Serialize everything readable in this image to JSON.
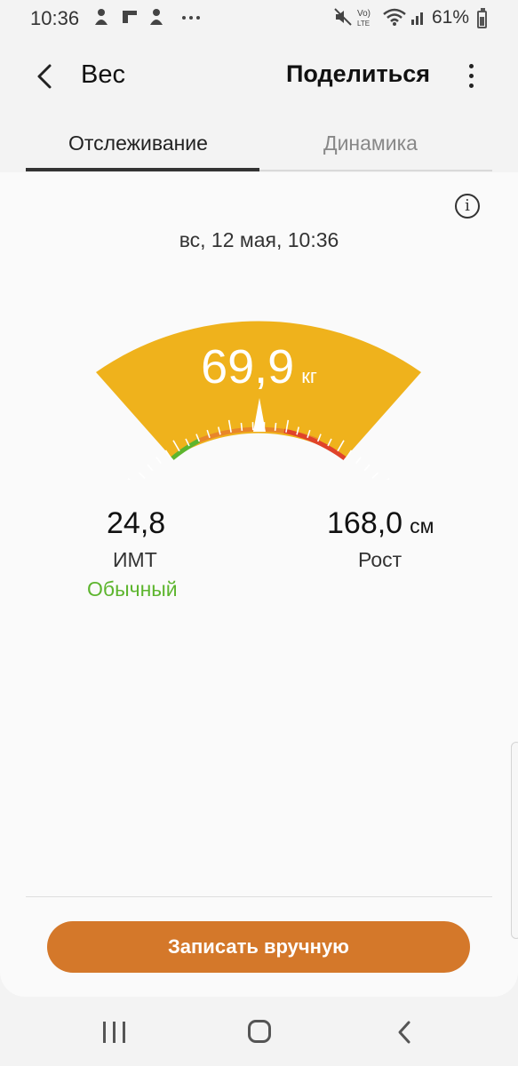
{
  "status_bar": {
    "time": "10:36",
    "notification_icons": [
      "android-notification-icon",
      "flipboard-icon",
      "android-notification-icon",
      "more-notifications-icon"
    ],
    "battery_percent": "61%"
  },
  "header": {
    "title": "Вес",
    "share_label": "Поделиться"
  },
  "tabs": [
    {
      "label": "Отслеживание",
      "active": true
    },
    {
      "label": "Динамика",
      "active": false
    }
  ],
  "measurement": {
    "date": "вс, 12 мая, 10:36",
    "weight_value": "69,9",
    "weight_unit": "кг"
  },
  "bmi": {
    "value": "24,8",
    "label": "ИМТ",
    "status": "Обычный"
  },
  "height": {
    "value": "168,0",
    "unit": "см",
    "label": "Рост"
  },
  "actions": {
    "record_manually": "Записать вручную"
  },
  "colors": {
    "gauge_fill": "#efb21c",
    "normal_green": "#5db52e",
    "warning_orange": "#e8862a",
    "danger_red": "#e0432a",
    "button_orange": "#d4782a"
  }
}
